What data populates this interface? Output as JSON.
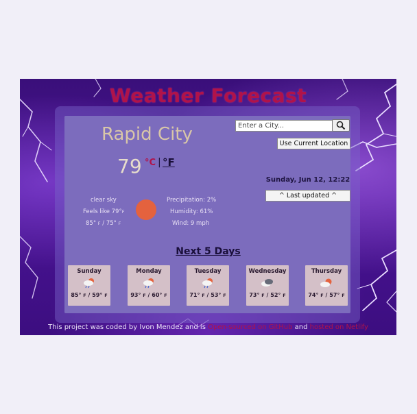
{
  "app": {
    "title": "Weather Forecast"
  },
  "search": {
    "placeholder": "Enter a City...",
    "button_icon": "search-icon"
  },
  "location_button": "Use Current Location",
  "current": {
    "city": "Rapid City",
    "temp": "79",
    "unit_c": "°C",
    "separator": "|",
    "unit_f": "°F",
    "description": "clear sky",
    "feels_like": "Feels like 79°",
    "feels_like_unit": "F",
    "high": "85°",
    "high_unit": "F",
    "high_low_sep": "/",
    "low": "75°",
    "low_unit": "F",
    "precipitation": "Precipitation: 2%",
    "humidity": "Humidity: 61%",
    "wind": "Wind: 9 mph",
    "icon": "sun-icon"
  },
  "date": "Sunday, Jun 12, 12:22",
  "last_updated": "^ Last updated ^",
  "forecast": {
    "heading": "Next 5 Days",
    "days": [
      {
        "name": "Sunday",
        "icon": "rain-cloud-icon",
        "high": "85°",
        "low": "59°",
        "unit": "F"
      },
      {
        "name": "Monday",
        "icon": "rain-cloud-icon",
        "high": "93°",
        "low": "60°",
        "unit": "F"
      },
      {
        "name": "Tuesday",
        "icon": "rain-cloud-icon",
        "high": "71°",
        "low": "53°",
        "unit": "F"
      },
      {
        "name": "Wednesday",
        "icon": "dark-cloud-icon",
        "high": "73°",
        "low": "52°",
        "unit": "F"
      },
      {
        "name": "Thursday",
        "icon": "sun-cloud-icon",
        "high": "74°",
        "low": "57°",
        "unit": "F"
      }
    ]
  },
  "footer": {
    "text1": "This project was coded by Ivon Mendez and is ",
    "link1": "Open-sourced on GitHub",
    "text2": " and ",
    "link2": "hosted on Netlify"
  },
  "colors": {
    "accent": "#b0134a",
    "card": "#7c6cbd",
    "sun": "#e4623e"
  }
}
